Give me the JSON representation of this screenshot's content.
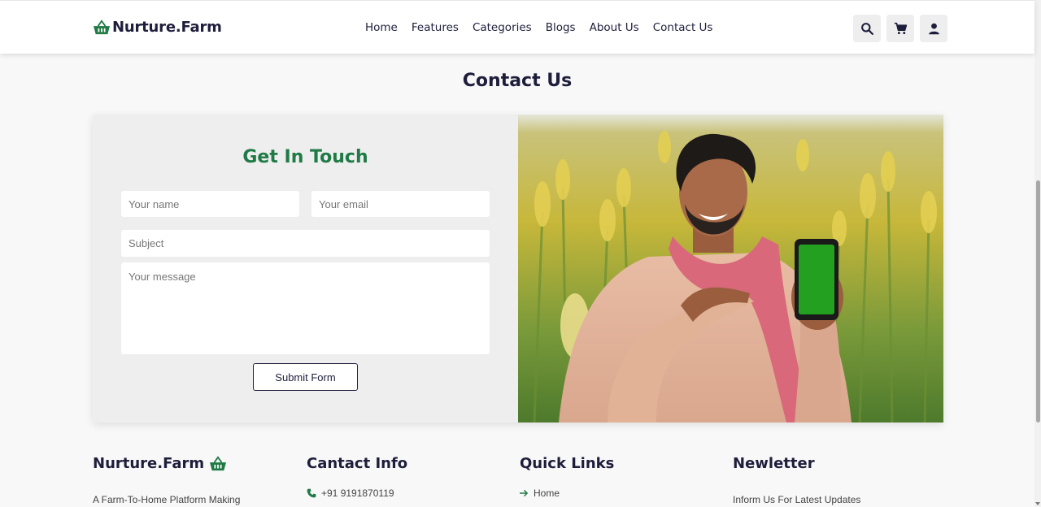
{
  "header": {
    "brand": "Nurture.Farm",
    "nav": [
      "Home",
      "Features",
      "Categories",
      "Blogs",
      "About Us",
      "Contact Us"
    ],
    "icons": [
      "search-icon",
      "cart-icon",
      "user-icon"
    ]
  },
  "page": {
    "title": "Contact Us"
  },
  "contact_form": {
    "heading": "Get In Touch",
    "name_placeholder": "Your name",
    "email_placeholder": "Your email",
    "subject_placeholder": "Subject",
    "message_placeholder": "Your message",
    "submit_label": "Submit Form"
  },
  "footer": {
    "brand": "Nurture.Farm",
    "brand_tagline": "A Farm-To-Home Platform Making",
    "contact_heading": "Cantact Info",
    "phone": "+91 9191870119",
    "links_heading": "Quick Links",
    "first_link": "Home",
    "newsletter_heading": "Newletter",
    "newsletter_text": "Inform Us For Latest Updates"
  },
  "colors": {
    "brand_green": "#1f7a45",
    "navy": "#1e1e3c",
    "background": "#f8f8f8",
    "card": "#eeeeee"
  }
}
